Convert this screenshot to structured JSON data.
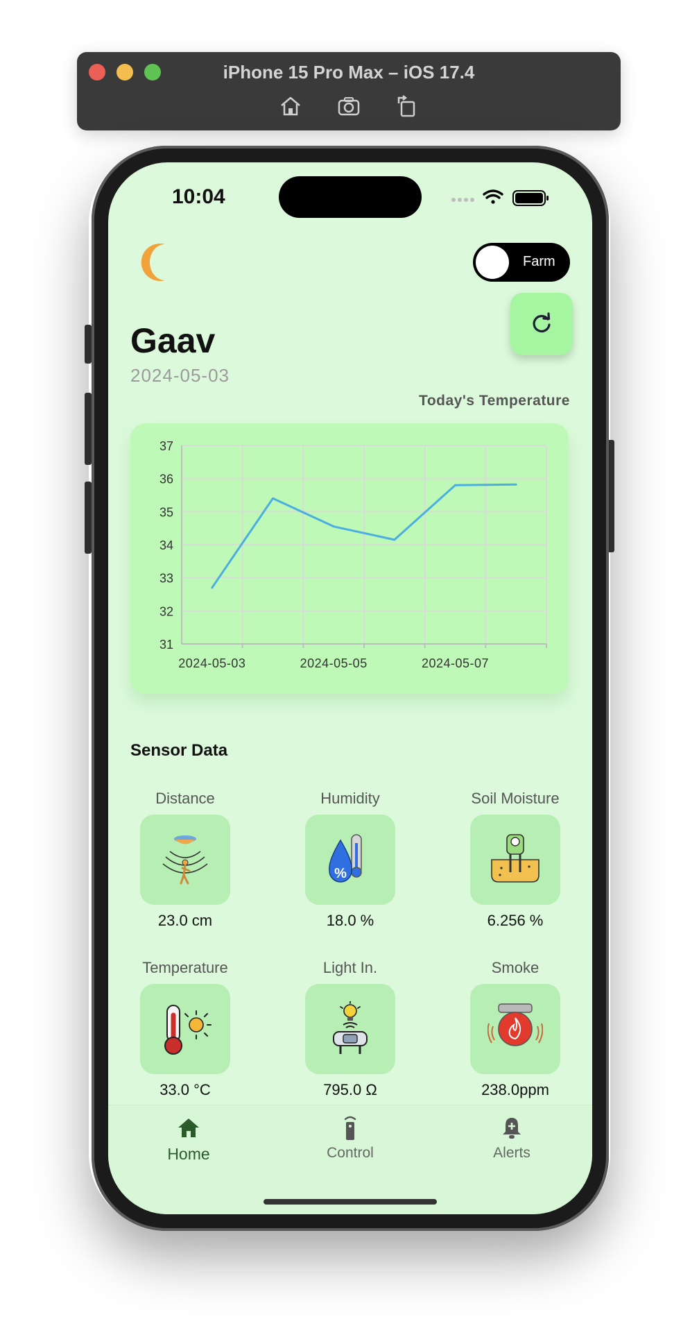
{
  "window": {
    "title": "iPhone 15 Pro Max – iOS 17.4",
    "tools": [
      "home-icon",
      "screenshot-icon",
      "rotate-icon"
    ]
  },
  "status_bar": {
    "time": "10:04"
  },
  "header": {
    "theme_icon": "moon-icon",
    "mode_toggle_label": "Farm",
    "refresh_icon": "refresh-icon",
    "title": "Gaav",
    "date": "2024-05-03"
  },
  "chart_data": {
    "type": "line",
    "title": "Today's Temperature",
    "xlabel": "",
    "ylabel": "",
    "x": [
      "2024-05-03",
      "2024-05-04",
      "2024-05-05",
      "2024-05-06",
      "2024-05-07",
      "2024-05-08"
    ],
    "x_tick_labels": [
      "2024-05-03",
      "2024-05-05",
      "2024-05-07"
    ],
    "series": [
      {
        "values": [
          32.7,
          35.4,
          34.55,
          34.15,
          35.8,
          35.82
        ]
      }
    ],
    "ylim": [
      31,
      37
    ],
    "y_ticks": [
      31,
      32,
      33,
      34,
      35,
      36,
      37
    ],
    "grid": true,
    "line_color": "#4aaee0"
  },
  "sensors": {
    "title": "Sensor Data",
    "items": [
      {
        "label": "Distance",
        "value": "23.0 cm",
        "icon": "ultrasonic-distance-icon"
      },
      {
        "label": "Humidity",
        "value": "18.0 %",
        "icon": "humidity-drop-icon"
      },
      {
        "label": "Soil Moisture",
        "value": "6.256 %",
        "icon": "soil-moisture-probe-icon"
      },
      {
        "label": "Temperature",
        "value": "33.0 °C",
        "icon": "thermometer-sun-icon"
      },
      {
        "label": "Light In.",
        "value": "795.0 Ω",
        "icon": "light-sensor-icon"
      },
      {
        "label": "Smoke",
        "value": "238.0ppm",
        "icon": "smoke-alarm-icon"
      }
    ]
  },
  "tabbar": {
    "tabs": [
      {
        "label": "Home",
        "icon": "home-icon",
        "active": true
      },
      {
        "label": "Control",
        "icon": "remote-control-icon",
        "active": false
      },
      {
        "label": "Alerts",
        "icon": "bell-icon",
        "active": false
      }
    ]
  },
  "colors": {
    "background": "#dcfadb",
    "chart_card": "#bff9b7",
    "tile": "#b6eeb3",
    "accent_dark_green": "#2b5a2b",
    "moon": "#f1a23a"
  }
}
